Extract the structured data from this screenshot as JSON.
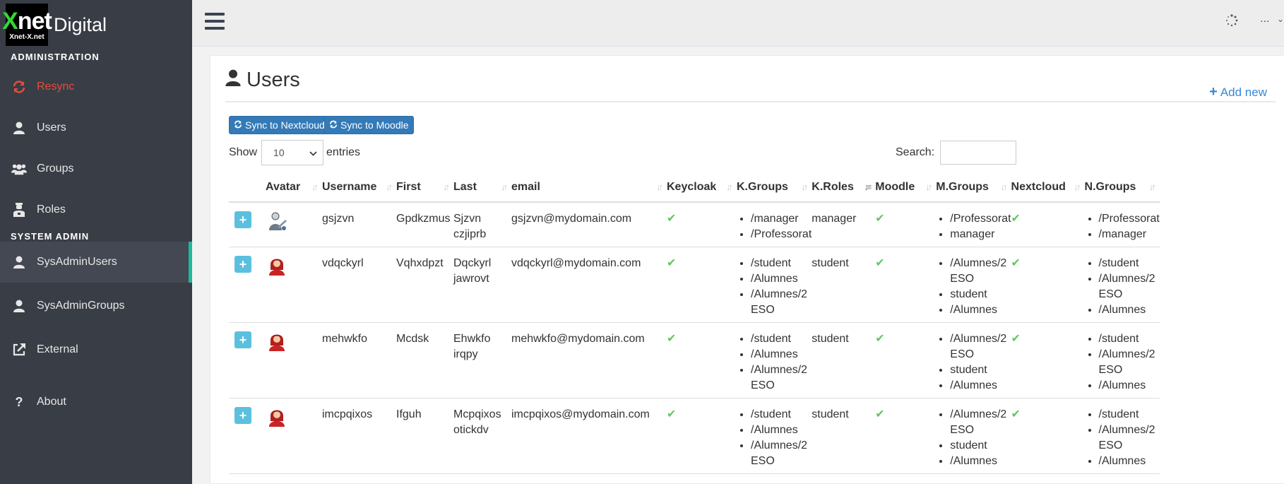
{
  "brand": {
    "logo_big": "Xnet",
    "logo_small": "Xnet-X.net",
    "name": "Digital"
  },
  "sidebar": {
    "section_admin": "ADMINISTRATION",
    "admin_items": [
      {
        "label": "Resync",
        "icon": "refresh-icon"
      },
      {
        "label": "Users",
        "icon": "user-icon"
      },
      {
        "label": "Groups",
        "icon": "users-icon"
      },
      {
        "label": "Roles",
        "icon": "roles-icon"
      }
    ],
    "section_sys": "SYSTEM ADMIN",
    "sys_items": [
      {
        "label": "SysAdminUsers",
        "icon": "user-icon"
      },
      {
        "label": "SysAdminGroups",
        "icon": "user-icon"
      },
      {
        "label": "External",
        "icon": "external-link-icon"
      },
      {
        "label": "About",
        "icon": "question-icon"
      }
    ]
  },
  "topbar": {
    "user_menu": "..."
  },
  "page": {
    "title": "Users",
    "add_new": "Add new",
    "sync_nextcloud": "Sync to Nextcloud",
    "sync_moodle": "Sync to Moodle",
    "show_label": "Show",
    "entries_value": "10",
    "entries_label": "entries",
    "search_label": "Search:"
  },
  "table": {
    "columns": [
      "",
      "Avatar",
      "Username",
      "First",
      "Last",
      "email",
      "Keycloak",
      "K.Groups",
      "K.Roles",
      "Moodle",
      "M.Groups",
      "Nextcloud",
      "N.Groups"
    ],
    "rows": [
      {
        "avatar": "admin-avatar",
        "username": "gsjzvn",
        "first": "Gpdkzmus",
        "last_1": "Sjzvn",
        "last_2": "czjiprb",
        "email": "gsjzvn@mydomain.com",
        "kgroups": [
          "/manager",
          "/Professorat"
        ],
        "kroles": "manager",
        "mgroups": [
          "/Professorat",
          "manager"
        ],
        "ngroups": [
          "/Professorat",
          "/manager"
        ]
      },
      {
        "avatar": "student-avatar",
        "username": "vdqckyrl",
        "first": "Vqhxdpzt",
        "last_1": "Dqckyrl",
        "last_2": "jawrovt",
        "email": "vdqckyrl@mydomain.com",
        "kgroups": [
          "/student",
          "/Alumnes",
          "/Alumnes/2 ESO"
        ],
        "kroles": "student",
        "mgroups": [
          "/Alumnes/2 ESO",
          "student",
          "/Alumnes"
        ],
        "ngroups": [
          "/student",
          "/Alumnes/2 ESO",
          "/Alumnes"
        ]
      },
      {
        "avatar": "student-avatar",
        "username": "mehwkfo",
        "first": "Mcdsk",
        "last_1": "Ehwkfo",
        "last_2": "irqpy",
        "email": "mehwkfo@mydomain.com",
        "kgroups": [
          "/student",
          "/Alumnes",
          "/Alumnes/2 ESO"
        ],
        "kroles": "student",
        "mgroups": [
          "/Alumnes/2 ESO",
          "student",
          "/Alumnes"
        ],
        "ngroups": [
          "/student",
          "/Alumnes/2 ESO",
          "/Alumnes"
        ]
      },
      {
        "avatar": "student-avatar",
        "username": "imcpqixos",
        "first": "Ifguh",
        "last_1": "Mcpqixos",
        "last_2": "otickdv",
        "email": "imcpqixos@mydomain.com",
        "kgroups": [
          "/student",
          "/Alumnes",
          "/Alumnes/2 ESO"
        ],
        "kroles": "student",
        "mgroups": [
          "/Alumnes/2 ESO",
          "student",
          "/Alumnes"
        ],
        "ngroups": [
          "/student",
          "/Alumnes/2 ESO",
          "/Alumnes"
        ]
      }
    ]
  },
  "colors": {
    "sidebar_bg": "#393d45",
    "active_marker": "#1abb9c",
    "danger": "#e74c3c",
    "primary": "#337ab7",
    "info": "#5bc0de",
    "check": "#5fc95f"
  }
}
